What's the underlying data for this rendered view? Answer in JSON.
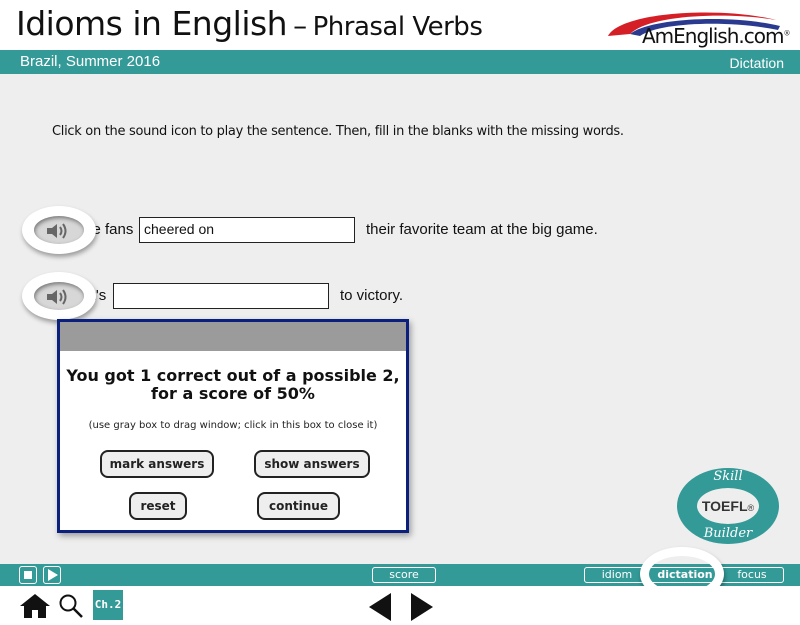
{
  "header": {
    "title_main": "Idioms in English",
    "title_dash": "–",
    "title_sub": "Phrasal Verbs",
    "logo_text": "AmEnglish.com",
    "logo_reg": "®"
  },
  "banner": {
    "left_text": "Brazil, Summer 2016",
    "right_text": "Dictation"
  },
  "instructions": "Click on the sound icon to play the sentence. Then, fill in the blanks with the missing words.",
  "sentences": [
    {
      "prefix": "The fans",
      "input_value": "cheered on",
      "suffix": "their favorite team at the big game.",
      "sound_icon": "speaker-icon"
    },
    {
      "prefix": "Let's",
      "input_value": "",
      "suffix": "to victory.",
      "sound_icon": "speaker-icon"
    }
  ],
  "dialog": {
    "score_line_1": "You got 1 correct out of a possible 2,",
    "score_line_2": "for a score of 50%",
    "correct": 1,
    "possible": 2,
    "score_percent": 50,
    "hint": "(use gray box to drag window; click in this box to close it)",
    "buttons": {
      "mark_answers": "mark answers",
      "show_answers": "show answers",
      "reset": "reset",
      "continue": "continue"
    }
  },
  "badge": {
    "top": "Skill",
    "middle": "TOEFL",
    "reg": "®",
    "bottom": "Builder"
  },
  "toolbar": {
    "stop_icon": "stop-icon",
    "play_icon": "play-icon",
    "score_label": "score",
    "modes": [
      {
        "label": "idiom",
        "active": false
      },
      {
        "label": "dictation",
        "active": true
      },
      {
        "label": "focus",
        "active": false
      }
    ]
  },
  "nav": {
    "home_icon": "home-icon",
    "search_icon": "search-icon",
    "chapter_label": "Ch.2",
    "prev_icon": "prev-arrow-icon",
    "next_icon": "next-arrow-icon"
  },
  "colors": {
    "teal": "#349a98",
    "dialog_border": "#0b1f7c",
    "drag_bar": "#9b9b9b",
    "content_bg": "#eeeeee"
  }
}
